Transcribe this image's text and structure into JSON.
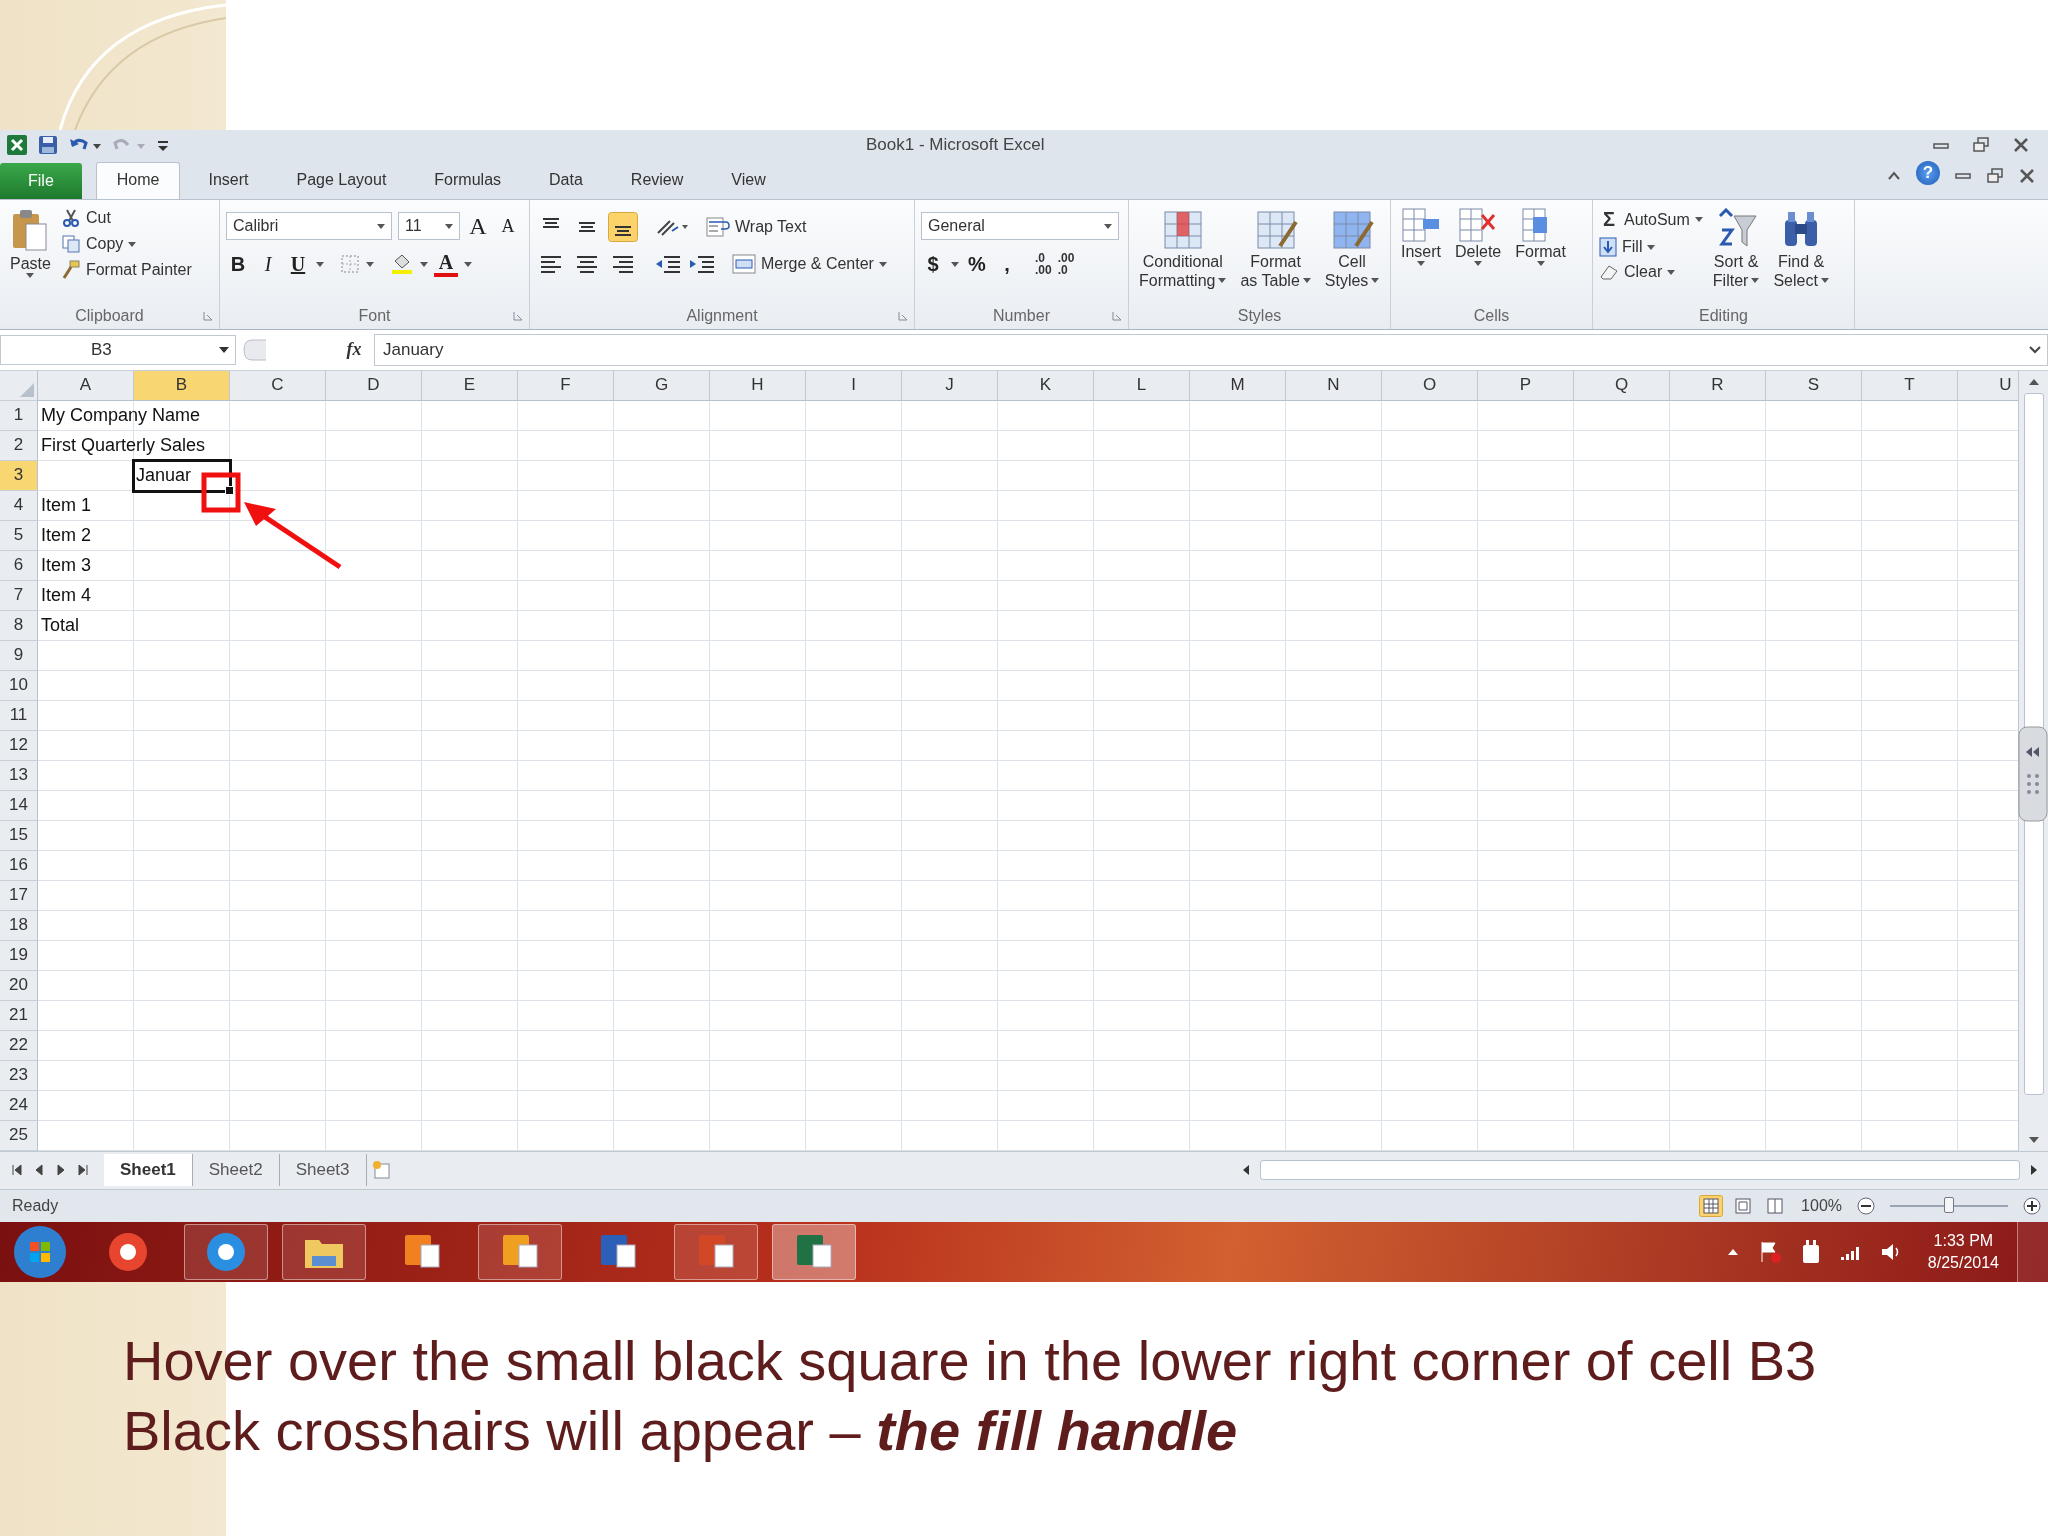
{
  "window": {
    "title": "Book1  -  Microsoft Excel",
    "help": "?"
  },
  "ribbon_tabs": [
    {
      "label": "File",
      "kind": "file",
      "selected": false
    },
    {
      "label": "Home",
      "kind": "tab",
      "selected": true
    },
    {
      "label": "Insert",
      "kind": "tab",
      "selected": false
    },
    {
      "label": "Page Layout",
      "kind": "tab",
      "selected": false
    },
    {
      "label": "Formulas",
      "kind": "tab",
      "selected": false
    },
    {
      "label": "Data",
      "kind": "tab",
      "selected": false
    },
    {
      "label": "Review",
      "kind": "tab",
      "selected": false
    },
    {
      "label": "View",
      "kind": "tab",
      "selected": false
    }
  ],
  "ribbon": {
    "clipboard": {
      "label": "Clipboard",
      "paste": "Paste",
      "cut": "Cut",
      "copy": "Copy",
      "format_painter": "Format Painter"
    },
    "font": {
      "label": "Font",
      "font_name": "Calibri",
      "font_size": "11",
      "grow": "A",
      "shrink": "A",
      "bold": "B",
      "italic": "I",
      "underline": "U",
      "font_color": "A"
    },
    "alignment": {
      "label": "Alignment",
      "vertical_align": [
        {
          "selected": false
        },
        {
          "selected": false
        },
        {
          "selected": true
        }
      ],
      "wrap_text": "Wrap Text",
      "merge_center": "Merge & Center"
    },
    "number": {
      "label": "Number",
      "format": "General",
      "currency": "$",
      "percent": "%",
      "comma": ",",
      "increase_decimal": [
        ".0",
        ".00"
      ],
      "decrease_decimal": [
        ".00",
        ".0"
      ]
    },
    "styles": {
      "label": "Styles",
      "buttons": [
        [
          "Conditional",
          "Formatting"
        ],
        [
          "Format",
          "as Table"
        ],
        [
          "Cell",
          "Styles"
        ]
      ]
    },
    "cells": {
      "label": "Cells",
      "buttons": [
        "Insert",
        "Delete",
        "Format"
      ]
    },
    "editing": {
      "label": "Editing",
      "autosum_sign": "Σ",
      "autosum": "AutoSum",
      "fill": "Fill",
      "clear": "Clear",
      "sort": [
        "Sort &",
        "Filter"
      ],
      "find": [
        "Find &",
        "Select"
      ]
    }
  },
  "formula_bar": {
    "name_box": "B3",
    "function_sign": "fx",
    "value": "January"
  },
  "columns": [
    {
      "label": "A",
      "selected": false
    },
    {
      "label": "B",
      "selected": true
    },
    {
      "label": "C",
      "selected": false
    },
    {
      "label": "D",
      "selected": false
    },
    {
      "label": "E",
      "selected": false
    },
    {
      "label": "F",
      "selected": false
    },
    {
      "label": "G",
      "selected": false
    },
    {
      "label": "H",
      "selected": false
    },
    {
      "label": "I",
      "selected": false
    },
    {
      "label": "J",
      "selected": false
    },
    {
      "label": "K",
      "selected": false
    },
    {
      "label": "L",
      "selected": false
    },
    {
      "label": "M",
      "selected": false
    },
    {
      "label": "N",
      "selected": false
    },
    {
      "label": "O",
      "selected": false
    },
    {
      "label": "P",
      "selected": false
    },
    {
      "label": "Q",
      "selected": false
    },
    {
      "label": "R",
      "selected": false
    },
    {
      "label": "S",
      "selected": false
    },
    {
      "label": "T",
      "selected": false
    },
    {
      "label": "U",
      "selected": false
    }
  ],
  "rows": [
    {
      "label": "1",
      "selected": false,
      "cells": {
        "A": {
          "text": "My Company Name",
          "active": false
        }
      }
    },
    {
      "label": "2",
      "selected": false,
      "cells": {
        "A": {
          "text": "First Quarterly Sales",
          "active": false
        }
      }
    },
    {
      "label": "3",
      "selected": true,
      "cells": {
        "B": {
          "text": "Januar",
          "active": true
        }
      }
    },
    {
      "label": "4",
      "selected": false,
      "cells": {
        "A": {
          "text": "Item 1",
          "active": false
        }
      }
    },
    {
      "label": "5",
      "selected": false,
      "cells": {
        "A": {
          "text": "Item 2",
          "active": false
        }
      }
    },
    {
      "label": "6",
      "selected": false,
      "cells": {
        "A": {
          "text": "Item 3",
          "active": false
        }
      }
    },
    {
      "label": "7",
      "selected": false,
      "cells": {
        "A": {
          "text": "Item 4",
          "active": false
        }
      }
    },
    {
      "label": "8",
      "selected": false,
      "cells": {
        "A": {
          "text": "Total",
          "active": false
        }
      }
    },
    {
      "label": "9",
      "selected": false
    },
    {
      "label": "10",
      "selected": false
    },
    {
      "label": "11",
      "selected": false
    },
    {
      "label": "12",
      "selected": false
    },
    {
      "label": "13",
      "selected": false
    },
    {
      "label": "14",
      "selected": false
    },
    {
      "label": "15",
      "selected": false
    },
    {
      "label": "16",
      "selected": false
    },
    {
      "label": "17",
      "selected": false
    },
    {
      "label": "18",
      "selected": false
    },
    {
      "label": "19",
      "selected": false
    },
    {
      "label": "20",
      "selected": false
    },
    {
      "label": "21",
      "selected": false
    },
    {
      "label": "22",
      "selected": false
    },
    {
      "label": "23",
      "selected": false
    },
    {
      "label": "24",
      "selected": false
    },
    {
      "label": "25",
      "selected": false
    }
  ],
  "sheet_tabs": [
    {
      "label": "Sheet1",
      "selected": true
    },
    {
      "label": "Sheet2",
      "selected": false
    },
    {
      "label": "Sheet3",
      "selected": false
    }
  ],
  "status_bar": {
    "status": "Ready",
    "views": [
      {
        "selected": true
      },
      {
        "selected": false
      },
      {
        "selected": false
      }
    ],
    "zoom": "100%",
    "zoom_slider": {
      "level": 0.5
    }
  },
  "taskbar": {
    "items": [
      {
        "kind": "start",
        "color": "#2f7fd0",
        "running": false,
        "selected": false
      },
      {
        "kind": "round",
        "color": "#e8452f",
        "running": false,
        "selected": false
      },
      {
        "kind": "round",
        "color": "#2a8fe0",
        "running": true,
        "selected": false
      },
      {
        "kind": "folder",
        "color": "#f0c860",
        "running": true,
        "selected": false
      },
      {
        "kind": "tile",
        "color": "#f08020",
        "running": false,
        "selected": false
      },
      {
        "kind": "tile",
        "color": "#f0a020",
        "running": true,
        "selected": false
      },
      {
        "kind": "tile",
        "color": "#2b5fb8",
        "running": false,
        "selected": false
      },
      {
        "kind": "tile",
        "color": "#d24726",
        "running": true,
        "selected": false
      },
      {
        "kind": "tile",
        "color": "#207245",
        "running": true,
        "selected": true
      }
    ],
    "time": "1:33 PM",
    "date": "8/25/2014"
  },
  "caption": [
    {
      "text": "Hover over the small black square in the lower right corner of cell B3"
    },
    {
      "text": "Black crosshairs will appear – ",
      "emphasis": "the fill handle"
    }
  ]
}
